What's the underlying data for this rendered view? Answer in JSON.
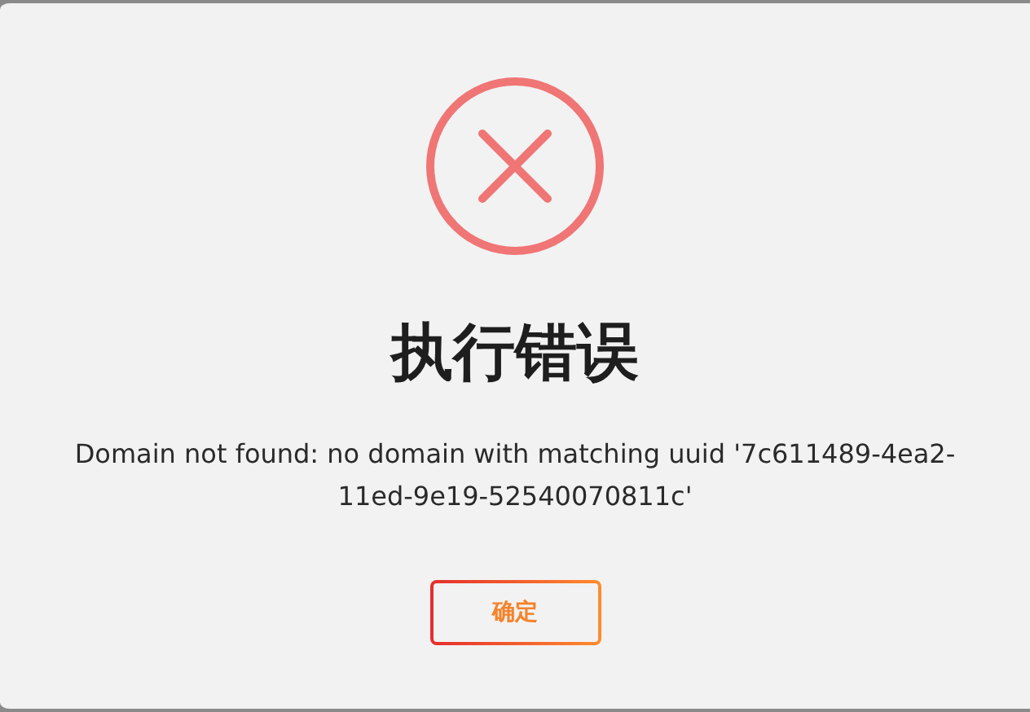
{
  "dialog": {
    "title": "执行错误",
    "message": "Domain not found: no domain with matching uuid '7c611489-4ea2-11ed-9e19-52540070811c'",
    "buttons": [
      {
        "label": "确定"
      }
    ]
  }
}
